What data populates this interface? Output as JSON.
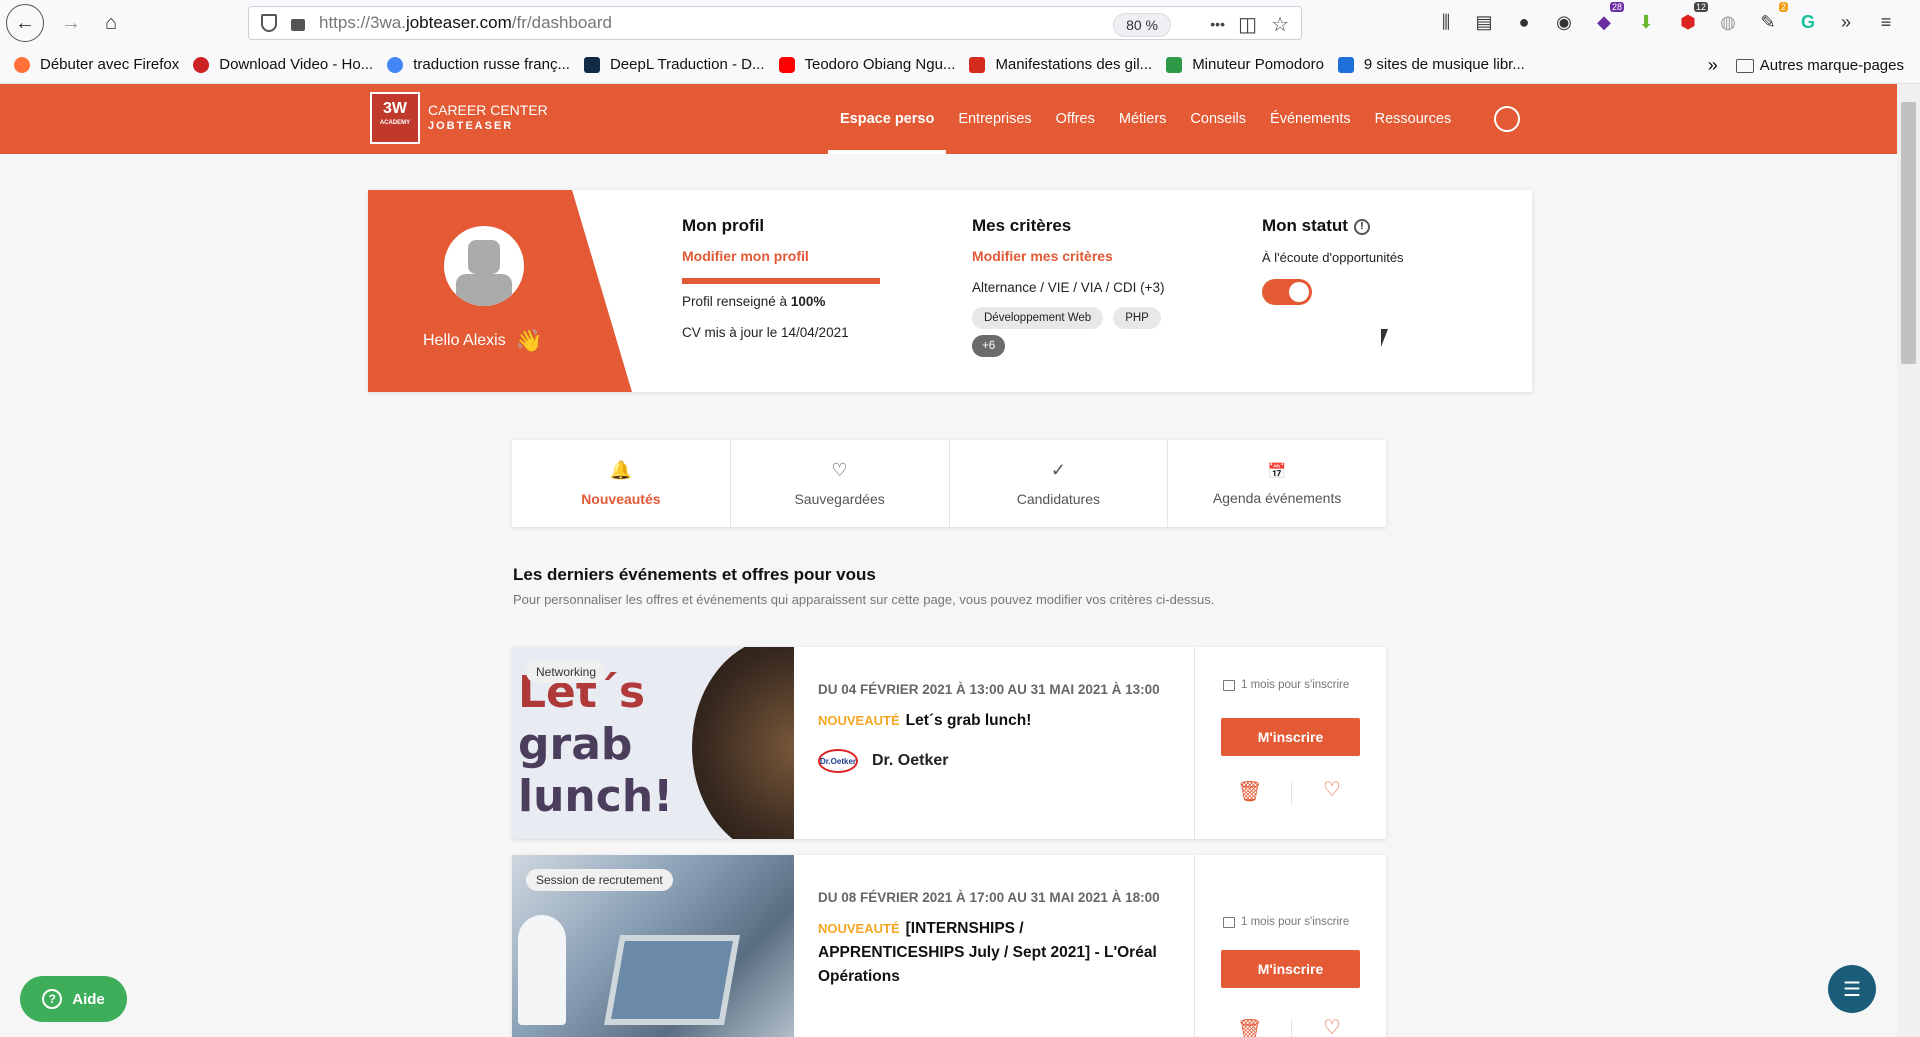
{
  "browser": {
    "url_prefix": "https://3wa.",
    "url_domain": "jobteaser.com",
    "url_path": "/fr/dashboard",
    "zoom": "80 %",
    "more": "•••",
    "ext_badges": [
      "28",
      "12",
      "2"
    ],
    "bookmarks": [
      {
        "label": "Débuter avec Firefox",
        "color": "#ff7139"
      },
      {
        "label": "Download Video - Ho...",
        "color": "#cc2222"
      },
      {
        "label": "traduction russe franç...",
        "color": "#4285f4"
      },
      {
        "label": "DeepL Traduction - D...",
        "color": "#0f2b46"
      },
      {
        "label": "Teodoro Obiang Ngu...",
        "color": "#ff0000"
      },
      {
        "label": "Manifestations des gil...",
        "color": "#d52b1e"
      },
      {
        "label": "Minuteur Pomodoro",
        "color": "#2e9a48"
      },
      {
        "label": "9 sites de musique libr...",
        "color": "#1e6fd9"
      }
    ],
    "other_bookmarks": "Autres marque-pages"
  },
  "site": {
    "logo_text": "3W",
    "logo_sub": "ACADEMY",
    "brand_line1": "CAREER CENTER",
    "brand_line2": "JOBTEASER",
    "nav": [
      "Espace perso",
      "Entreprises",
      "Offres",
      "Métiers",
      "Conseils",
      "Événements",
      "Ressources"
    ]
  },
  "profile": {
    "hello": "Hello Alexis",
    "wave": "👋",
    "profile_title": "Mon profil",
    "profile_link": "Modifier mon profil",
    "profile_progress_percent": 100,
    "profile_filled": "Profil renseigné à",
    "profile_filled_value": "100%",
    "cv_updated": "CV mis à jour le 14/04/2021",
    "criteria_title": "Mes critères",
    "criteria_link": "Modifier mes critères",
    "criteria_types": "Alternance / VIE / VIA / CDI (+3)",
    "chips": [
      "Développement Web",
      "PHP"
    ],
    "chip_more": "+6",
    "status_title": "Mon statut",
    "status_text": "À l'écoute d'opportunités",
    "status_on": true
  },
  "tabs": [
    {
      "label": "Nouveautés",
      "icon": "🔔"
    },
    {
      "label": "Sauvegardées",
      "icon": "♡"
    },
    {
      "label": "Candidatures",
      "icon": "✓"
    },
    {
      "label": "Agenda événements",
      "icon": "📅"
    }
  ],
  "section": {
    "title": "Les derniers événements et offres pour vous",
    "subtitle": "Pour personnaliser les offres et événements qui apparaissent sur cette page, vous pouvez modifier vos critères ci-dessus."
  },
  "events": [
    {
      "badge": "Networking",
      "image_text_1": "Let´s",
      "image_text_2": "grab",
      "image_text_3": "lunch!",
      "date": "Du 04 février 2021 à 13:00 au 31 mai 2021 à 13:00",
      "new_label": "NOUVEAUTÉ",
      "title": "Let´s grab lunch!",
      "company": "Dr. Oetker",
      "company_logo_text": "Dr.Oetker",
      "deadline": "1 mois pour s'inscrire",
      "cta": "M'inscrire"
    },
    {
      "badge": "Session de recrutement",
      "date": "Du 08 février 2021 à 17:00 au 31 mai 2021 à 18:00",
      "new_label": "NOUVEAUTÉ",
      "title": "[INTERNSHIPS / APPRENTICESHIPS July / Sept 2021] - L'Oréal Opérations",
      "deadline": "1 mois pour s'inscrire",
      "cta": "M'inscrire"
    }
  ],
  "help": {
    "label": "Aide",
    "icon": "?"
  }
}
